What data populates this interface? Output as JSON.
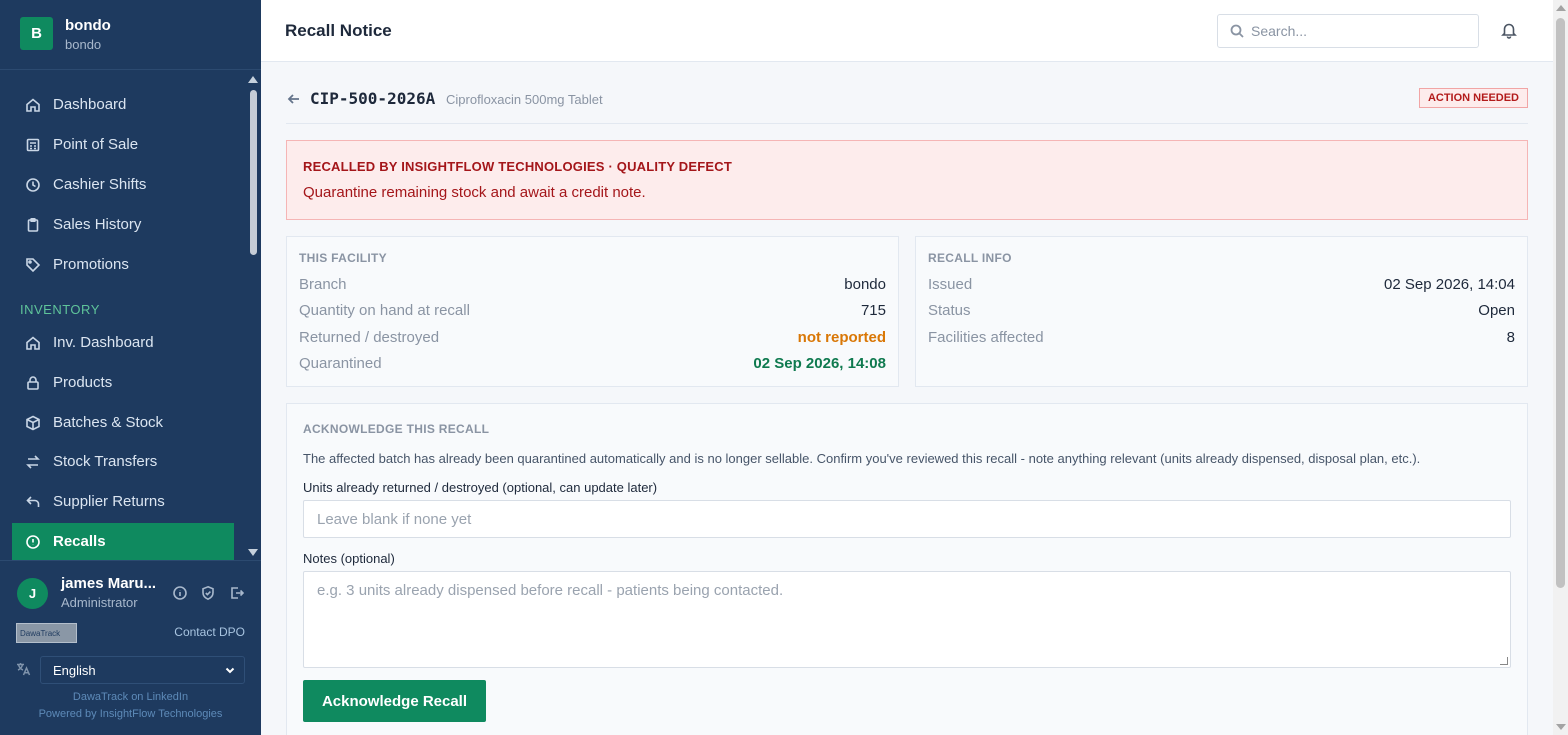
{
  "brand": {
    "initial": "B",
    "name": "bondo",
    "sub": "bondo"
  },
  "nav": {
    "items": [
      {
        "label": "Dashboard",
        "icon": "home-icon"
      },
      {
        "label": "Point of Sale",
        "icon": "register-icon"
      },
      {
        "label": "Cashier Shifts",
        "icon": "clock-icon"
      },
      {
        "label": "Sales History",
        "icon": "clipboard-icon"
      },
      {
        "label": "Promotions",
        "icon": "tag-icon"
      }
    ],
    "section_inventory": "INVENTORY",
    "inventory_items": [
      {
        "label": "Inv. Dashboard",
        "icon": "home-icon"
      },
      {
        "label": "Products",
        "icon": "lock-icon"
      },
      {
        "label": "Batches & Stock",
        "icon": "box-icon"
      },
      {
        "label": "Stock Transfers",
        "icon": "transfer-icon"
      },
      {
        "label": "Supplier Returns",
        "icon": "return-icon"
      },
      {
        "label": "Recalls",
        "icon": "alert-circle-icon",
        "active": true
      }
    ]
  },
  "user": {
    "initial": "J",
    "name": "james Maru...",
    "role": "Administrator",
    "contact_dpo": "Contact DPO",
    "logo_text": "DawaTrack",
    "language": "English",
    "footer_linkedin": "DawaTrack on LinkedIn",
    "footer_powered": "Powered by InsightFlow Technologies"
  },
  "topbar": {
    "title": "Recall Notice",
    "search_placeholder": "Search..."
  },
  "recall": {
    "batch_code": "CIP-500-2026A",
    "product": "Ciprofloxacin 500mg Tablet",
    "badge": "ACTION NEEDED",
    "alert_title": "RECALLED BY INSIGHTFLOW TECHNOLOGIES · QUALITY DEFECT",
    "alert_message": "Quarantine remaining stock and await a credit note."
  },
  "facility": {
    "title": "THIS FACILITY",
    "rows": [
      {
        "label": "Branch",
        "value": "bondo"
      },
      {
        "label": "Quantity on hand at recall",
        "value": "715"
      },
      {
        "label": "Returned / destroyed",
        "value": "not reported"
      },
      {
        "label": "Quarantined",
        "value": "02 Sep 2026, 14:08"
      }
    ]
  },
  "recall_info": {
    "title": "RECALL INFO",
    "rows": [
      {
        "label": "Issued",
        "value": "02 Sep 2026, 14:04"
      },
      {
        "label": "Status",
        "value": "Open"
      },
      {
        "label": "Facilities affected",
        "value": "8"
      }
    ]
  },
  "acknowledge": {
    "title": "ACKNOWLEDGE THIS RECALL",
    "description": "The affected batch has already been quarantined automatically and is no longer sellable. Confirm you've reviewed this recall - note anything relevant (units already dispensed, disposal plan, etc.).",
    "units_label": "Units already returned / destroyed (optional, can update later)",
    "units_placeholder": "Leave blank if none yet",
    "notes_label": "Notes (optional)",
    "notes_placeholder": "e.g. 3 units already dispensed before recall - patients being contacted.",
    "button": "Acknowledge Recall"
  },
  "colors": {
    "sidebar_bg": "#1e3a5f",
    "accent": "#0f8a5f",
    "alert_bg": "#fdecec",
    "alert_text": "#a4161a",
    "warn": "#d97706"
  }
}
